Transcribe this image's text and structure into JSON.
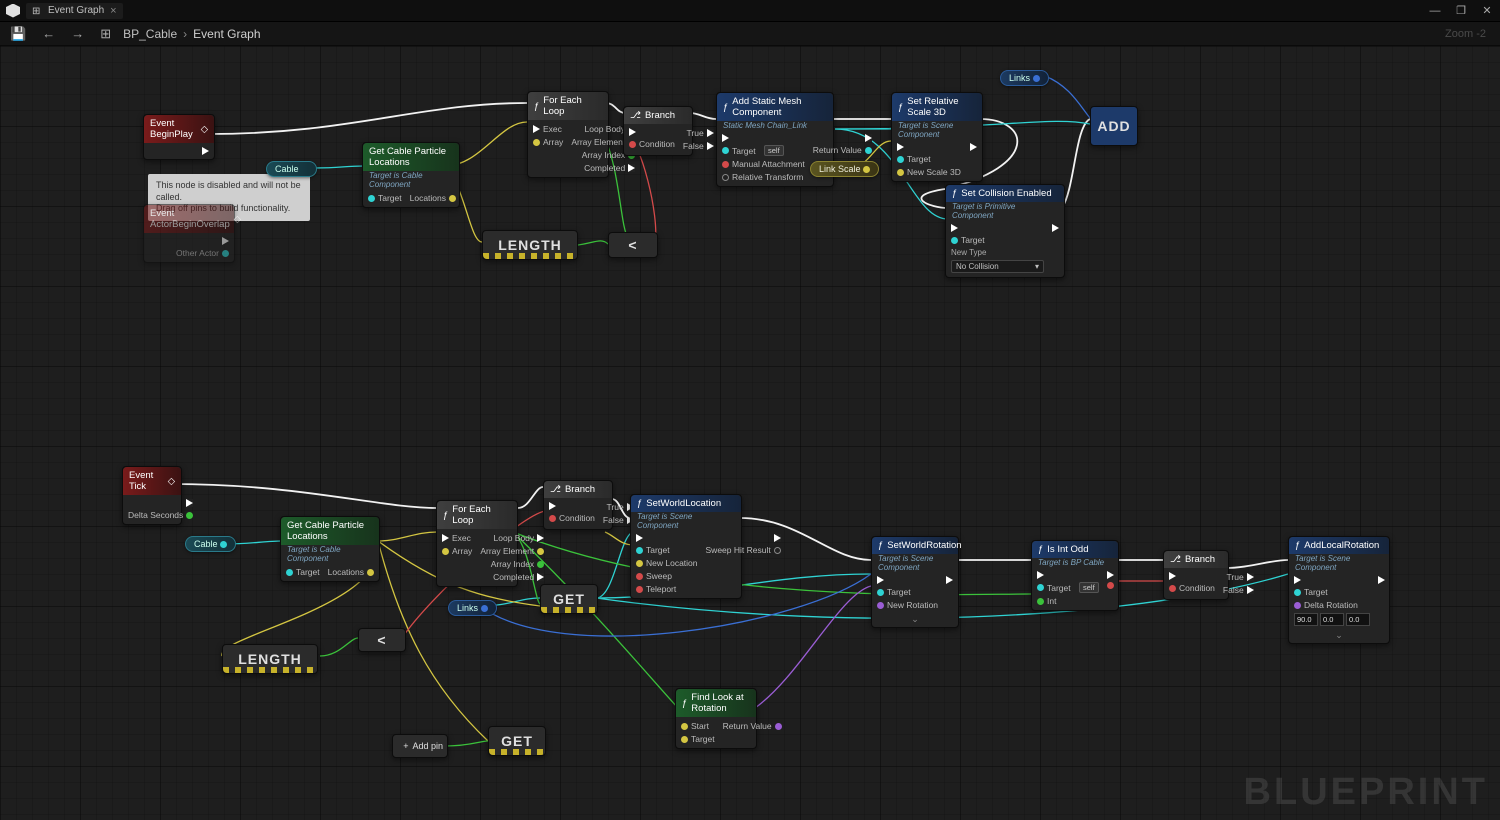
{
  "titlebar": {
    "tab_title": "Event Graph",
    "tab_close": "×"
  },
  "win": {
    "min": "—",
    "max": "❐",
    "close": "✕"
  },
  "toolbar": {
    "save": "💾",
    "back": "←",
    "fwd": "→",
    "graph_icon": "⊞"
  },
  "breadcrumb": {
    "bp": "BP_Cable",
    "sep": "›",
    "current": "Event Graph"
  },
  "zoom": "Zoom -2",
  "watermark": "BLUEPRINT",
  "tooltip": {
    "line1": "This node is disabled and will not be called.",
    "line2": "Drag off pins to build functionality."
  },
  "vars": {
    "cable": "Cable",
    "links": "Links",
    "link_scale": "Link Scale"
  },
  "nodes": {
    "begin_play": {
      "title": "Event BeginPlay"
    },
    "actor_overlap": {
      "title": "Event ActorBeginOverlap",
      "pin_other": "Other Actor"
    },
    "get_particle1": {
      "title": "Get Cable Particle Locations",
      "sub": "Target is Cable Component",
      "pin_target": "Target",
      "pin_locs": "Locations"
    },
    "foreach1": {
      "title": "For Each Loop",
      "pin_exec": "Exec",
      "pin_array": "Array",
      "pin_body": "Loop Body",
      "pin_elem": "Array Element",
      "pin_idx": "Array Index",
      "pin_done": "Completed"
    },
    "branch1": {
      "title": "Branch",
      "pin_cond": "Condition",
      "pin_true": "True",
      "pin_false": "False"
    },
    "add_smc": {
      "title": "Add Static Mesh Component",
      "sub": "Static Mesh Chain_Link",
      "pin_target": "Target",
      "self": "self",
      "pin_manual": "Manual Attachment",
      "pin_rel": "Relative Transform",
      "pin_ret": "Return Value"
    },
    "set_scale": {
      "title": "Set Relative Scale 3D",
      "sub": "Target is Scene Component",
      "pin_target": "Target",
      "pin_scale": "New Scale 3D"
    },
    "set_collision": {
      "title": "Set Collision Enabled",
      "sub": "Target is Primitive Component",
      "pin_target": "Target",
      "pin_type": "New Type",
      "val_type": "No Collision"
    },
    "array_add": {
      "title": "ADD"
    },
    "length1": {
      "title": "LENGTH"
    },
    "less1": {
      "op": "<"
    },
    "event_tick": {
      "title": "Event Tick",
      "pin_delta": "Delta Seconds"
    },
    "get_particle2": {
      "title": "Get Cable Particle Locations",
      "sub": "Target is Cable Component",
      "pin_target": "Target",
      "pin_locs": "Locations"
    },
    "foreach2": {
      "title": "For Each Loop",
      "pin_exec": "Exec",
      "pin_array": "Array",
      "pin_body": "Loop Body",
      "pin_elem": "Array Element",
      "pin_idx": "Array Index",
      "pin_done": "Completed"
    },
    "branch2": {
      "title": "Branch",
      "pin_cond": "Condition",
      "pin_true": "True",
      "pin_false": "False"
    },
    "set_world_loc": {
      "title": "SetWorldLocation",
      "sub": "Target is Scene Component",
      "pin_target": "Target",
      "pin_newloc": "New Location",
      "pin_sweep": "Sweep",
      "pin_teleport": "Teleport",
      "pin_hit": "Sweep Hit Result"
    },
    "set_world_rot": {
      "title": "SetWorldRotation",
      "sub": "Target is Scene Component",
      "pin_target": "Target",
      "pin_newrot": "New Rotation"
    },
    "is_int_odd": {
      "title": "Is Int Odd",
      "sub": "Target is BP Cable",
      "pin_target": "Target",
      "self": "self",
      "pin_int": "Int"
    },
    "branch3": {
      "title": "Branch",
      "pin_cond": "Condition",
      "pin_true": "True",
      "pin_false": "False"
    },
    "add_local_rot": {
      "title": "AddLocalRotation",
      "sub": "Target is Scene Component",
      "pin_target": "Target",
      "pin_delta": "Delta Rotation",
      "rx": "90.0",
      "ry": "0.0",
      "rz": "0.0"
    },
    "find_look": {
      "title": "Find Look at Rotation",
      "pin_start": "Start",
      "pin_target": "Target",
      "pin_ret": "Return Value"
    },
    "length2": {
      "title": "LENGTH"
    },
    "less2": {
      "op": "<"
    },
    "get1": {
      "title": "GET"
    },
    "get2": {
      "title": "GET"
    },
    "links_pill": {
      "label": "Links"
    },
    "addpin": {
      "label": "Add pin",
      "plus": "+"
    }
  }
}
